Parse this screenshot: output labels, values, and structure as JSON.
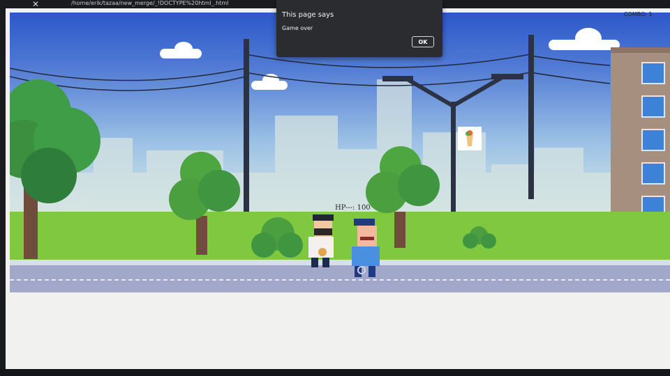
{
  "browser": {
    "close_glyph": "✕",
    "url": "/home/erik/tazaa/new_merge/_!DOCTYPE%20html_.html"
  },
  "game": {
    "hp_label": "HP---: 100",
    "combo_label": "COMBO: 1",
    "colors": {
      "sky_top": "#2d58c9",
      "sky_bottom": "#dceee6",
      "grass": "#80c83f",
      "road": "#a2a8c9",
      "building": "#a78f7f"
    },
    "characters": [
      "player",
      "police-officer"
    ],
    "pickup_icon": "shawarma-icon"
  },
  "dialog": {
    "title": "This page says",
    "message": "Game over",
    "ok_label": "OK"
  }
}
